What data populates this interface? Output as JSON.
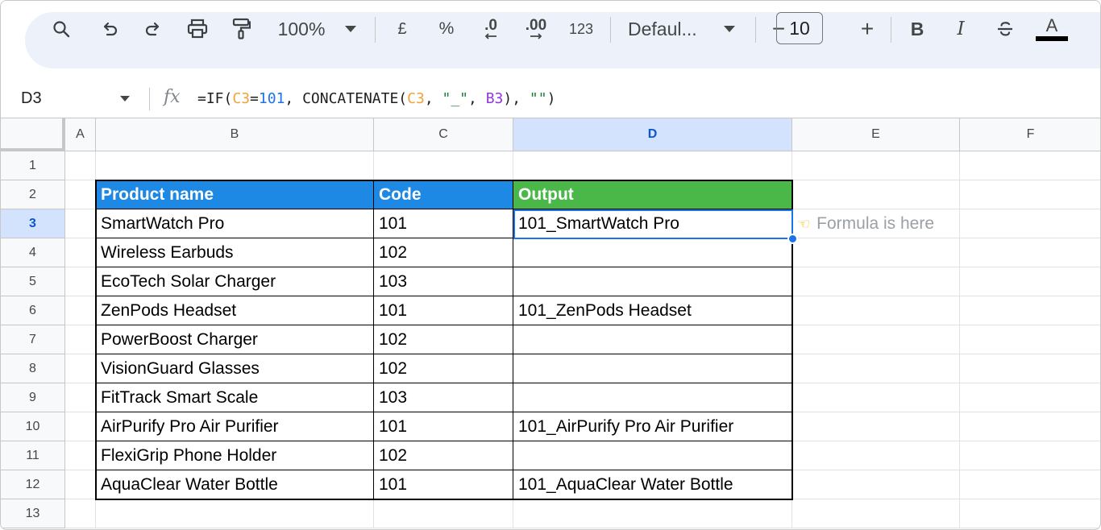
{
  "toolbar": {
    "zoom": "100%",
    "currency": "£",
    "percent": "%",
    "decrease_decimal": ".0",
    "increase_decimal": ".00",
    "number_format": "123",
    "font": "Defaul...",
    "font_size": "10",
    "minus": "−",
    "plus": "+",
    "bold": "B",
    "italic": "I",
    "text_color_letter": "A",
    "text_color": "#000000"
  },
  "formula_bar": {
    "cell_ref": "D3",
    "fx": "fx",
    "formula_parts": [
      "=IF(",
      "C3",
      "=",
      "101",
      ", CONCATENATE(",
      "C3",
      ", ",
      "\"_\"",
      ", ",
      "B3",
      "), ",
      "\"\"",
      ")"
    ]
  },
  "columns": [
    "A",
    "B",
    "C",
    "D",
    "E",
    "F"
  ],
  "rows": [
    "1",
    "2",
    "3",
    "4",
    "5",
    "6",
    "7",
    "8",
    "9",
    "10",
    "11",
    "12",
    "13"
  ],
  "table": {
    "headers": [
      "Product name",
      "Code",
      "Output"
    ],
    "rows": [
      [
        "SmartWatch Pro",
        "101",
        "101_SmartWatch Pro"
      ],
      [
        "Wireless Earbuds",
        "102",
        ""
      ],
      [
        "EcoTech Solar Charger",
        "103",
        ""
      ],
      [
        "ZenPods Headset",
        "101",
        "101_ZenPods Headset"
      ],
      [
        "PowerBoost Charger",
        "102",
        ""
      ],
      [
        "VisionGuard Glasses",
        "102",
        ""
      ],
      [
        "FitTrack Smart Scale",
        "103",
        ""
      ],
      [
        "AirPurify Pro Air Purifier",
        "101",
        "101_AirPurify Pro Air Purifier"
      ],
      [
        "FlexiGrip Phone Holder",
        "102",
        ""
      ],
      [
        "AquaClear Water Bottle",
        "101",
        "101_AquaClear Water Bottle"
      ]
    ]
  },
  "annotation": "Formula is here",
  "colors": {
    "header_blue": "#1e88e5",
    "header_green": "#4ab848",
    "selection": "#1a73e8"
  }
}
